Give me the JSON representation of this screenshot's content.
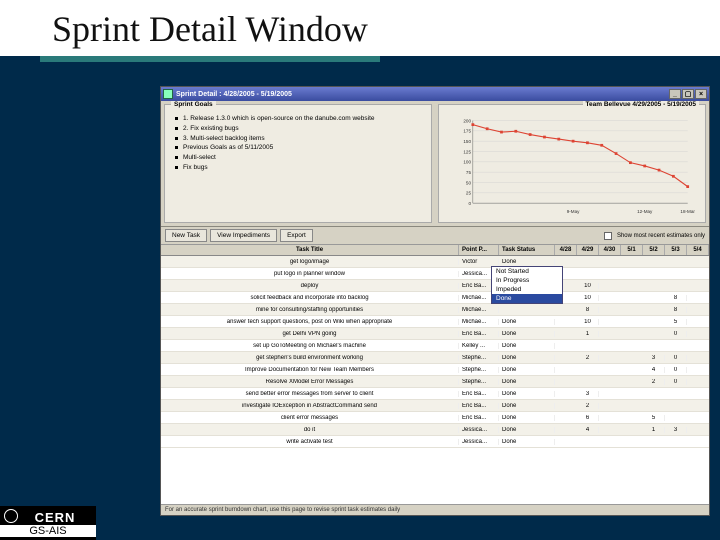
{
  "slide": {
    "title": "Sprint Detail Window"
  },
  "window": {
    "title": "Sprint Detail : 4/28/2005 - 5/19/2005",
    "buttons": {
      "min": "_",
      "max": "▢",
      "close": "×"
    }
  },
  "goals": {
    "heading": "Sprint Goals",
    "items": [
      "1. Release 1.3.0 which is open-source on the danube.com website",
      "2. Fix existing bugs",
      "3. Multi-select backlog items",
      "",
      "Previous Goals as of 5/11/2005",
      "Multi-select",
      "Fix bugs"
    ]
  },
  "chart_title": "Team Bellevue 4/29/2005 - 5/19/2005",
  "chart_data": {
    "type": "line",
    "title": "Team Bellevue 4/29/2005 - 5/19/2005",
    "xlabel": "",
    "ylabel": "",
    "ylim": [
      0,
      200
    ],
    "yticks": [
      0,
      25,
      50,
      75,
      100,
      125,
      150,
      175,
      200
    ],
    "categories": [
      "",
      "",
      "",
      "",
      "",
      "",
      "",
      "9-May",
      "",
      "",
      "",
      "",
      "12-May",
      "",
      "",
      "18-Mar"
    ],
    "values": [
      190,
      180,
      172,
      174,
      166,
      160,
      155,
      150,
      146,
      140,
      120,
      98,
      90,
      80,
      65,
      40
    ]
  },
  "toolbar": {
    "new_task": "New Task",
    "view_impediments": "View Impediments",
    "export": "Export",
    "checkbox_label": "Show most recent estimates only"
  },
  "columns": {
    "title": "Task Title",
    "point_person": "Point P...",
    "status": "Task Status",
    "days": [
      "4/28",
      "4/29",
      "4/30",
      "5/1",
      "5/2",
      "5/3",
      "5/4"
    ]
  },
  "status_options": [
    "Not Started",
    "In Progress",
    "Impeded",
    "Done"
  ],
  "rows": [
    {
      "title": "get logo/image",
      "pp": "Victor",
      "status": "Done",
      "d": [
        "",
        "",
        "",
        "",
        "",
        "",
        ""
      ]
    },
    {
      "title": "put logo in planner window",
      "pp": "Jessica...",
      "status": "Done",
      "d": [
        "",
        "",
        "",
        "",
        "",
        "",
        ""
      ]
    },
    {
      "title": "deploy",
      "pp": "Eric Ba...",
      "status": "",
      "d": [
        "",
        "10",
        "",
        "",
        "",
        "",
        ""
      ]
    },
    {
      "title": "solicit feedback and incorporate into backlog",
      "pp": "Michae...",
      "status": "",
      "d": [
        "",
        "10",
        "",
        "",
        "",
        "8",
        ""
      ]
    },
    {
      "title": "mine for consulting/staffing opportunities",
      "pp": "Michae...",
      "status": "",
      "d": [
        "",
        "8",
        "",
        "",
        "",
        "8",
        ""
      ]
    },
    {
      "title": "answer tech support questions, post on Wiki when appropriate",
      "pp": "Michae...",
      "status": "Done",
      "d": [
        "",
        "10",
        "",
        "",
        "",
        "5",
        ""
      ]
    },
    {
      "title": "get Delhi VPN going",
      "pp": "Eric Ba...",
      "status": "Done",
      "d": [
        "",
        "1",
        "",
        "",
        "",
        "0",
        ""
      ]
    },
    {
      "title": "set up GoToMeeting on Michael's machine",
      "pp": "Kelley ...",
      "status": "Done",
      "d": [
        "",
        "",
        "",
        "",
        "",
        "",
        ""
      ]
    },
    {
      "title": "get stephen's build environment working",
      "pp": "Stephe...",
      "status": "Done",
      "d": [
        "",
        "2",
        "",
        "",
        "3",
        "0",
        ""
      ]
    },
    {
      "title": "Improve Documentation for New Team Members",
      "pp": "Stephe...",
      "status": "Done",
      "d": [
        "",
        "",
        "",
        "",
        "4",
        "0",
        ""
      ]
    },
    {
      "title": "Resolve XModel Error Messages",
      "pp": "Stephe...",
      "status": "Done",
      "d": [
        "",
        "",
        "",
        "",
        "2",
        "0",
        ""
      ]
    },
    {
      "title": "send better error messages from server to client",
      "pp": "Eric Ba...",
      "status": "Done",
      "d": [
        "",
        "3",
        "",
        "",
        "",
        "",
        ""
      ]
    },
    {
      "title": "investigate IOException in AbstractCommand send",
      "pp": "Eric Ba...",
      "status": "Done",
      "d": [
        "",
        "2",
        "",
        "",
        "",
        "",
        ""
      ]
    },
    {
      "title": "client error messages",
      "pp": "Eric Ba...",
      "status": "Done",
      "d": [
        "",
        "6",
        "",
        "",
        "5",
        "",
        ""
      ]
    },
    {
      "title": "do it",
      "pp": "Jessica...",
      "status": "Done",
      "d": [
        "",
        "4",
        "",
        "",
        "1",
        "3",
        ""
      ]
    },
    {
      "title": "write activate test",
      "pp": "Jessica...",
      "status": "Done",
      "d": [
        "",
        "",
        "",
        "",
        "",
        "",
        ""
      ]
    }
  ],
  "footer": "For an accurate sprint burndown chart, use this page to revise sprint task estimates daily",
  "badge": {
    "line1": "CERN",
    "line2": "GS-AIS"
  }
}
